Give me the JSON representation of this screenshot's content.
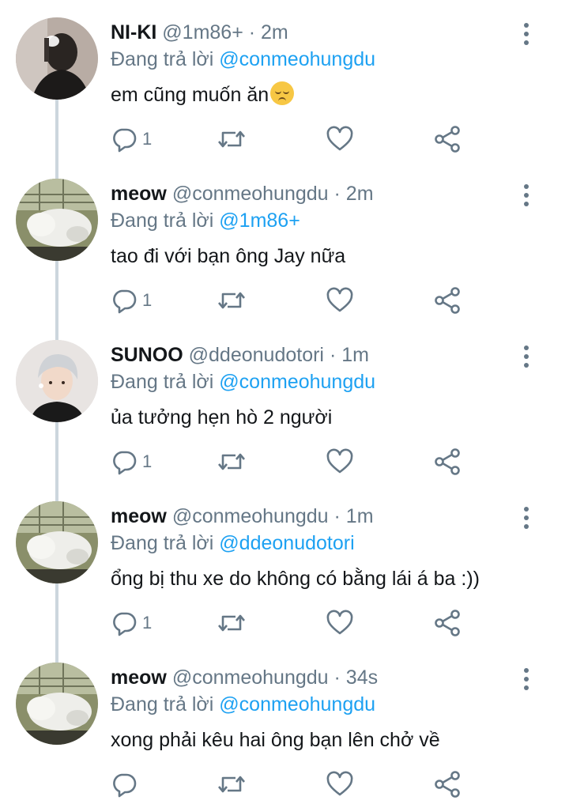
{
  "tweets": [
    {
      "name": "NI-KI",
      "handle": "@1m86+",
      "sep": "·",
      "time": "2m",
      "replying_prefix": "Đang trả lời",
      "replying_to": "@conmeohungdu",
      "text": "em cũng muốn ăn",
      "emoji": "pensive-face-emoji",
      "reply_count": "1",
      "avatar": "person-dark-avatar"
    },
    {
      "name": "meow",
      "handle": "@conmeohungdu",
      "sep": "·",
      "time": "2m",
      "replying_prefix": "Đang trả lời",
      "replying_to": "@1m86+",
      "text": "tao đi với bạn ông Jay nữa",
      "reply_count": "1",
      "avatar": "cat-avatar"
    },
    {
      "name": "SUNOO",
      "handle": "@ddeonudotori",
      "sep": "·",
      "time": "1m",
      "replying_prefix": "Đang trả lời",
      "replying_to": "@conmeohungdu",
      "text": "ủa tưởng hẹn hò 2 người",
      "reply_count": "1",
      "avatar": "person-silver-hair-avatar"
    },
    {
      "name": "meow",
      "handle": "@conmeohungdu",
      "sep": "·",
      "time": "1m",
      "replying_prefix": "Đang trả lời",
      "replying_to": "@ddeonudotori",
      "text": "ổng bị thu xe do không có bằng lái á ba :))",
      "reply_count": "1",
      "avatar": "cat-avatar"
    },
    {
      "name": "meow",
      "handle": "@conmeohungdu",
      "sep": "·",
      "time": "34s",
      "replying_prefix": "Đang trả lời",
      "replying_to": "@conmeohungdu",
      "text": "xong phải kêu hai ông bạn lên chở về",
      "reply_count": "",
      "avatar": "cat-avatar"
    }
  ],
  "icons": {
    "reply": "reply-icon",
    "retweet": "retweet-icon",
    "like": "heart-icon",
    "share": "share-icon",
    "more": "more-vertical-icon"
  },
  "colors": {
    "mention": "#1da1f2",
    "secondary": "#657786",
    "thread_line": "#ccd6dd"
  }
}
